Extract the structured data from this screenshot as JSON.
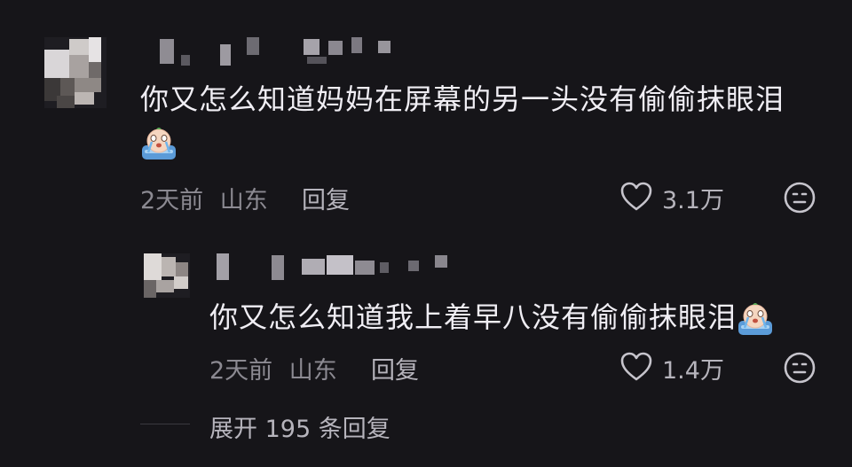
{
  "comment": {
    "text": "你又怎么知道妈妈在屏幕的另一头没有偷偷抹眼泪",
    "emoji": "crying-emoji",
    "time": "2天前",
    "location": "山东",
    "reply_label": "回复",
    "like_count": "3.1万"
  },
  "reply": {
    "text": "你又怎么知道我上着早八没有偷偷抹眼泪",
    "emoji": "crying-emoji",
    "time": "2天前",
    "location": "山东",
    "reply_label": "回复",
    "like_count": "1.4万"
  },
  "expand_label": "展开 195 条回复"
}
